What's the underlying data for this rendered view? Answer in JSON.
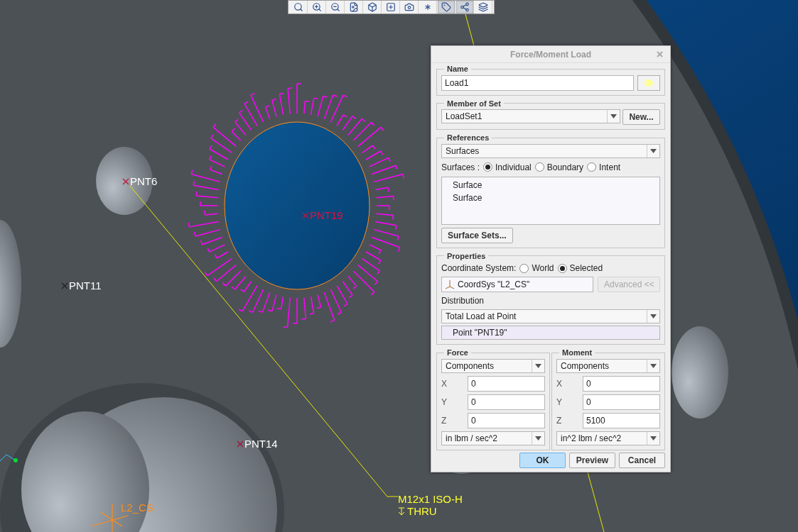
{
  "toolbar": {
    "buttons": [
      {
        "kind": "zoom-fit",
        "selected": false
      },
      {
        "kind": "zoom-in",
        "selected": false
      },
      {
        "kind": "zoom-out",
        "selected": false
      },
      {
        "kind": "repaint",
        "selected": false
      },
      {
        "kind": "view",
        "selected": false
      },
      {
        "kind": "named-view",
        "selected": false
      },
      {
        "kind": "camera",
        "selected": false
      },
      {
        "kind": "points",
        "selected": false
      },
      {
        "kind": "annotation",
        "selected": true
      },
      {
        "kind": "network",
        "selected": true
      },
      {
        "kind": "layers",
        "selected": false
      }
    ]
  },
  "viewport": {
    "points": [
      {
        "label": "PNT6",
        "color": "#c0143c"
      },
      {
        "label": "PNT19",
        "color": "#c0143c"
      },
      {
        "label": "PNT11",
        "color": "#202428"
      },
      {
        "label": "PNT14",
        "color": "#a0143c"
      }
    ],
    "note": {
      "lines": [
        "M12x1 ISO-H",
        "THRU"
      ]
    },
    "csys_label": "L2_CS"
  },
  "dialog": {
    "title": "Force/Moment Load",
    "name": {
      "legend": "Name",
      "value": "Load1"
    },
    "member_of_set": {
      "legend": "Member of Set",
      "value": "LoadSet1",
      "new_button": "New..."
    },
    "references": {
      "legend": "References",
      "type": "Surfaces",
      "surfaces_label": "Surfaces :",
      "options": [
        {
          "label": "Individual",
          "selected": true
        },
        {
          "label": "Boundary",
          "selected": false
        },
        {
          "label": "Intent",
          "selected": false
        }
      ],
      "list": [
        "Surface",
        "Surface"
      ],
      "surface_sets_button": "Surface Sets..."
    },
    "properties": {
      "legend": "Properties",
      "csys_label": "Coordinate System:",
      "csys_options": [
        {
          "label": "World",
          "selected": false
        },
        {
          "label": "Selected",
          "selected": true
        }
      ],
      "csys_value": "CoordSys \"L2_CS\"",
      "advanced_button": {
        "label": "Advanced <<",
        "disabled": true
      },
      "distribution_label": "Distribution",
      "distribution": "Total Load at Point",
      "point": "Point \"PNT19\""
    },
    "force": {
      "legend": "Force",
      "mode": "Components",
      "rows": [
        {
          "axis": "X",
          "value": "0"
        },
        {
          "axis": "Y",
          "value": "0"
        },
        {
          "axis": "Z",
          "value": "0"
        }
      ],
      "units": "in lbm / sec^2"
    },
    "moment": {
      "legend": "Moment",
      "mode": "Components",
      "rows": [
        {
          "axis": "X",
          "value": "0"
        },
        {
          "axis": "Y",
          "value": "0"
        },
        {
          "axis": "Z",
          "value": "5100"
        }
      ],
      "units": "in^2 lbm / sec^2"
    },
    "buttons": [
      {
        "label": "OK",
        "default": true
      },
      {
        "label": "Preview",
        "default": false
      },
      {
        "label": "Cancel",
        "default": false
      }
    ]
  }
}
